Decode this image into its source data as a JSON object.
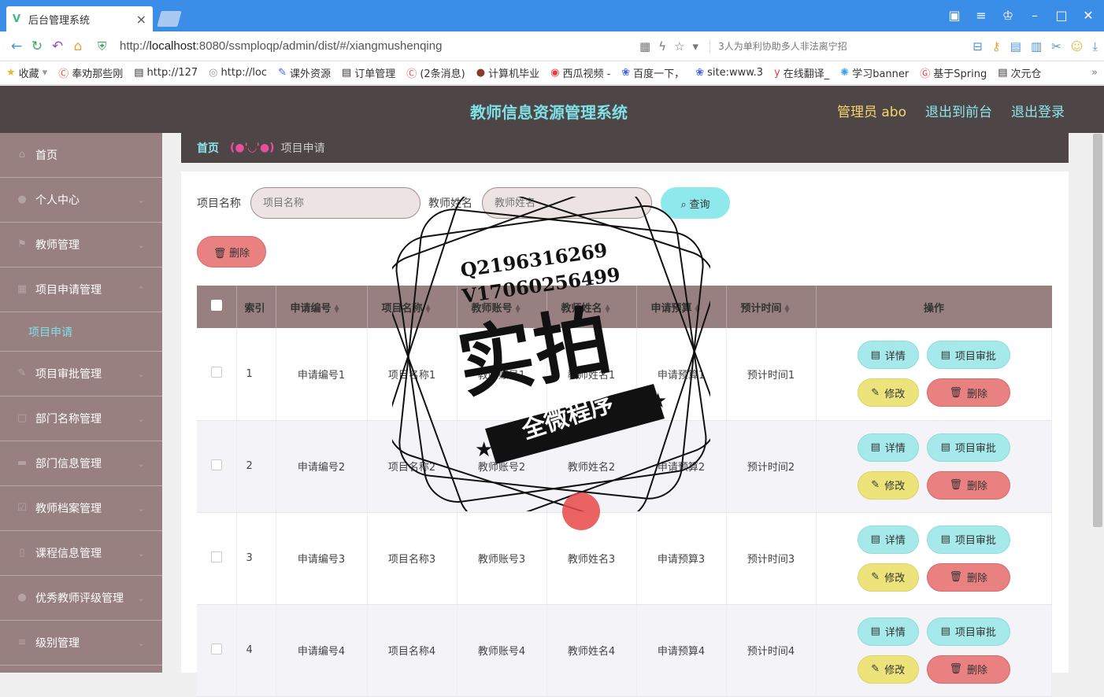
{
  "browser": {
    "tab_title": "后台管理系统",
    "url_prefix": "http://",
    "url_host": "localhost",
    "url_path": ":8080/ssmploqp/admin/dist/#/xiangmushenqing",
    "search_text": "3人为单利协助多人非法离宁招",
    "bookmarks": [
      "收藏",
      "奉劝那些刚",
      "http://127",
      "http://loc",
      "课外资源",
      "订单管理",
      "(2条消息)",
      "计算机毕业",
      "西瓜视频 -",
      "百度一下，",
      "site:www.3",
      "在线翻译_",
      "学习banner",
      "基于Spring",
      "次元仓"
    ]
  },
  "header": {
    "title": "教师信息资源管理系统",
    "admin_label": "管理员 abo",
    "to_front": "退出到前台",
    "logout": "退出登录"
  },
  "sidebar": {
    "items": [
      {
        "label": "首页",
        "icon": "home-icon"
      },
      {
        "label": "个人中心",
        "icon": "user-icon"
      },
      {
        "label": "教师管理",
        "icon": "flag-icon"
      },
      {
        "label": "项目申请管理",
        "icon": "grid-icon"
      },
      {
        "label": "项目审批管理",
        "icon": "edit-icon"
      },
      {
        "label": "部门名称管理",
        "icon": "doc-icon"
      },
      {
        "label": "部门信息管理",
        "icon": "folder-icon"
      },
      {
        "label": "教师档案管理",
        "icon": "check-icon"
      },
      {
        "label": "课程信息管理",
        "icon": "phone-icon"
      },
      {
        "label": "优秀教师评级管理",
        "icon": "user-icon"
      },
      {
        "label": "级别管理",
        "icon": "menu-icon"
      }
    ],
    "active_sub": "项目申请"
  },
  "breadcrumb": {
    "home": "首页",
    "separator": "(●'◡'●)",
    "current": "项目申请"
  },
  "search": {
    "name_label": "项目名称",
    "name_placeholder": "项目名称",
    "teacher_label": "教师姓名",
    "teacher_placeholder": "教师姓名",
    "query_button": "查询",
    "delete_button": "删除"
  },
  "table": {
    "headers": [
      "索引",
      "申请编号",
      "项目名称",
      "教师账号",
      "教师姓名",
      "申请预算",
      "预计时间",
      "操作"
    ],
    "rows": [
      {
        "index": "1",
        "code": "申请编号1",
        "name": "项目名称1",
        "account": "教师账号1",
        "teacher": "教师姓名1",
        "budget": "申请预算1",
        "time": "预计时间1"
      },
      {
        "index": "2",
        "code": "申请编号2",
        "name": "项目名称2",
        "account": "教师账号2",
        "teacher": "教师姓名2",
        "budget": "申请预算2",
        "time": "预计时间2"
      },
      {
        "index": "3",
        "code": "申请编号3",
        "name": "项目名称3",
        "account": "教师账号3",
        "teacher": "教师姓名3",
        "budget": "申请预算3",
        "time": "预计时间3"
      },
      {
        "index": "4",
        "code": "申请编号4",
        "name": "项目名称4",
        "account": "教师账号4",
        "teacher": "教师姓名4",
        "budget": "申请预算4",
        "time": "预计时间4"
      }
    ],
    "ops": {
      "detail": "详情",
      "audit": "项目审批",
      "edit": "修改",
      "delete": "删除"
    }
  },
  "watermark": {
    "line1": "Q2196316269",
    "line2": "V17060256499",
    "big": "实拍",
    "banner": "全微程序"
  },
  "colors": {
    "header_bg": "#4e4646",
    "sidebar_bg": "#988080",
    "accent_cyan": "#8fe9ec",
    "danger": "#e98181",
    "warning": "#ece37a"
  }
}
